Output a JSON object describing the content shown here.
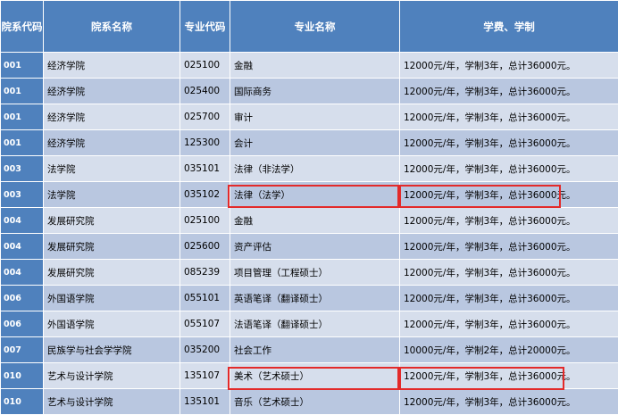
{
  "headers": [
    "院系代码",
    "院系名称",
    "专业代码",
    "专业名称",
    "学费、学制"
  ],
  "rows": [
    {
      "dept_code": "001",
      "dept_name": "经济学院",
      "major_code": "025100",
      "major_name": "金融",
      "fee": "12000元/年，学制3年，总计36000元。"
    },
    {
      "dept_code": "001",
      "dept_name": "经济学院",
      "major_code": "025400",
      "major_name": "国际商务",
      "fee": "12000元/年，学制3年，总计36000元。"
    },
    {
      "dept_code": "001",
      "dept_name": "经济学院",
      "major_code": "025700",
      "major_name": "审计",
      "fee": "12000元/年，学制3年，总计36000元。"
    },
    {
      "dept_code": "001",
      "dept_name": "经济学院",
      "major_code": "125300",
      "major_name": "会计",
      "fee": "12000元/年，学制3年，总计36000元。"
    },
    {
      "dept_code": "003",
      "dept_name": "法学院",
      "major_code": "035101",
      "major_name": "法律（非法学）",
      "fee": "12000元/年，学制3年，总计36000元。"
    },
    {
      "dept_code": "003",
      "dept_name": "法学院",
      "major_code": "035102",
      "major_name": "法律（法学）",
      "fee": "12000元/年，学制3年，总计36000元。",
      "highlighted": true
    },
    {
      "dept_code": "004",
      "dept_name": "发展研究院",
      "major_code": "025100",
      "major_name": "金融",
      "fee": "12000元/年，学制3年，总计36000元。"
    },
    {
      "dept_code": "004",
      "dept_name": "发展研究院",
      "major_code": "025600",
      "major_name": "资产评估",
      "fee": "12000元/年，学制3年，总计36000元。"
    },
    {
      "dept_code": "004",
      "dept_name": "发展研究院",
      "major_code": "085239",
      "major_name": "项目管理（工程硕士）",
      "fee": "12000元/年，学制3年，总计36000元。"
    },
    {
      "dept_code": "006",
      "dept_name": "外国语学院",
      "major_code": "055101",
      "major_name": "英语笔译（翻译硕士）",
      "fee": "12000元/年，学制3年，总计36000元。"
    },
    {
      "dept_code": "006",
      "dept_name": "外国语学院",
      "major_code": "055107",
      "major_name": "法语笔译（翻译硕士）",
      "fee": "12000元/年，学制3年，总计36000元。"
    },
    {
      "dept_code": "007",
      "dept_name": "民族学与社会学学院",
      "major_code": "035200",
      "major_name": "社会工作",
      "fee": "10000元/年，学制2年，总计20000元。"
    },
    {
      "dept_code": "010",
      "dept_name": "艺术与设计学院",
      "major_code": "135107",
      "major_name": "美术（艺术硕士）",
      "fee": "12000元/年，学制3年，总计36000元。",
      "highlighted": true
    },
    {
      "dept_code": "010",
      "dept_name": "艺术与设计学院",
      "major_code": "135101",
      "major_name": "音乐（艺术硕士）",
      "fee": "12000元/年，学制3年，总计36000元。"
    }
  ],
  "colors": {
    "header_bg": "#4f81bd",
    "row_light": "#d6deec",
    "row_dark": "#b9c7e0",
    "highlight_border": "#e32a2a"
  }
}
